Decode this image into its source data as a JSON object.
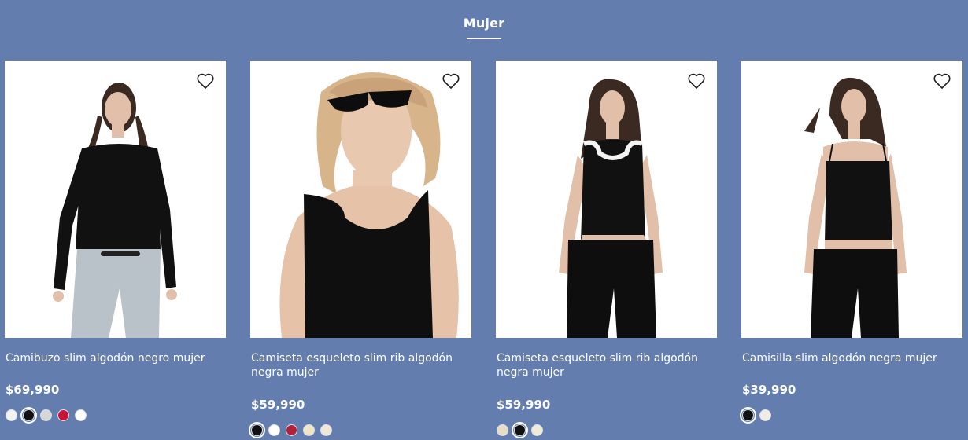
{
  "section": {
    "title": "Mujer"
  },
  "products": [
    {
      "name": "Camibuzo slim algodón negro mujer",
      "price": "$69,990",
      "swatches": [
        "#f2f2f2",
        "#111111",
        "#d6d6d6",
        "#c9143a",
        "#ffffff"
      ]
    },
    {
      "name": "Camiseta esqueleto slim rib algodón negra mujer",
      "price": "$59,990",
      "swatches": [
        "#111111",
        "#ffffff",
        "#b0213a",
        "#efe6c8",
        "#efe8d8"
      ]
    },
    {
      "name": "Camiseta esqueleto slim rib algodón negra mujer",
      "price": "$59,990",
      "swatches": [
        "#e8dcc4",
        "#111111",
        "#f0ead8"
      ]
    },
    {
      "name": "Camisilla slim algodón negra mujer",
      "price": "$39,990",
      "swatches": [
        "#111111",
        "#f2ece6"
      ]
    }
  ]
}
